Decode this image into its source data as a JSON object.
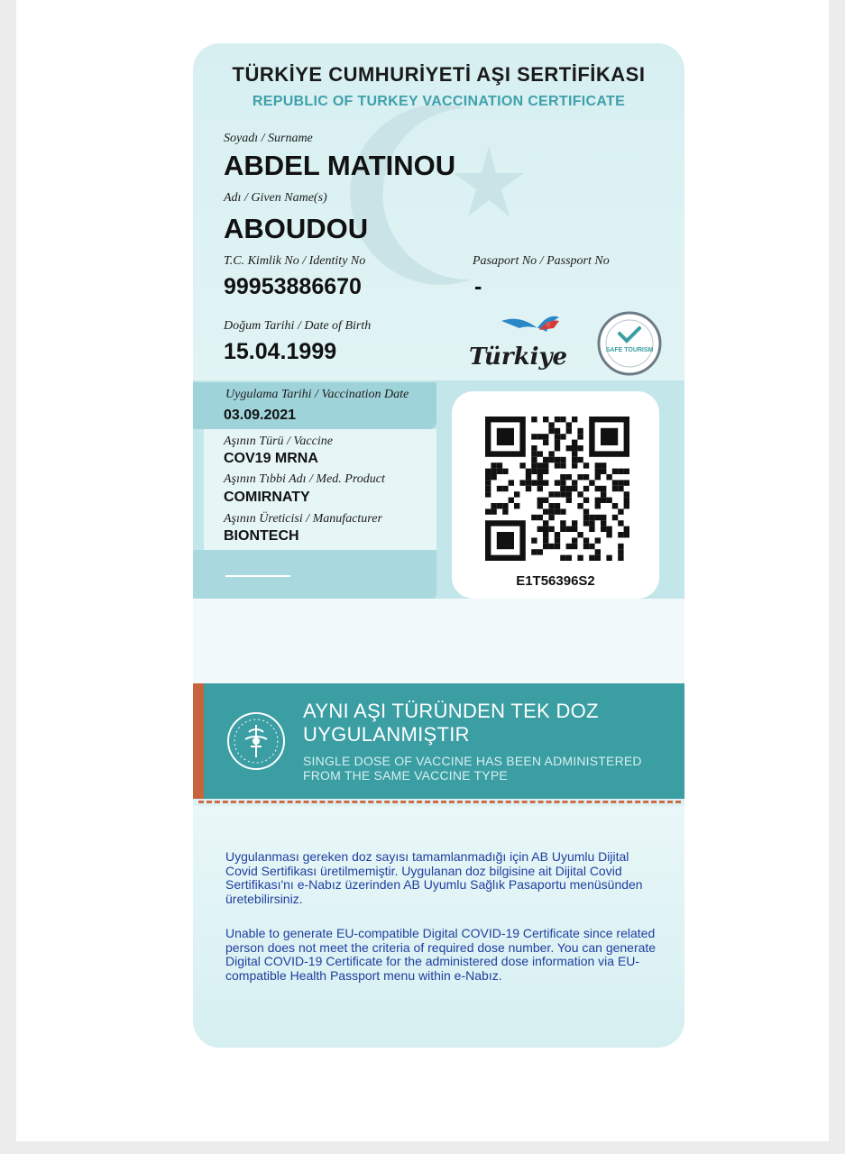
{
  "certificate": {
    "title_tr": "TÜRKİYE CUMHURİYETİ AŞI SERTİFİKASI",
    "title_en": "REPUBLIC OF TURKEY VACCINATION CERTIFICATE"
  },
  "person": {
    "surname_label": "Soyadı / Surname",
    "surname": "ABDEL MATINOU",
    "given_name_label": "Adı / Given Name(s)",
    "given_name": "ABOUDOU",
    "identity_label": "T.C. Kimlik No / Identity No",
    "identity": "99953886670",
    "passport_label": "Pasaport No / Passport No",
    "passport": "-",
    "dob_label": "Doğum Tarihi / Date of Birth",
    "dob": "15.04.1999"
  },
  "logos": {
    "turkiye_wordmark": "Türkiye",
    "safe_tourism_text": "SAFE TOURISM",
    "colors": {
      "crescent": "#c9e3e6",
      "qr_dark": "#111111",
      "teal_banner": "#3a9ea3",
      "accent": "#c8643d",
      "note_text": "#1f3fa0"
    }
  },
  "vaccination": {
    "date_label": "Uygulama Tarihi / Vaccination Date",
    "date": "03.09.2021",
    "vaccine_label": "Aşının Türü / Vaccine",
    "vaccine": "COV19 MRNA",
    "product_label": "Aşının Tıbbi Adı / Med. Product",
    "product": "COMIRNATY",
    "manufacturer_label": "Aşının Üreticisi / Manufacturer",
    "manufacturer": "BIONTECH"
  },
  "qr": {
    "code": "E1T56396S2",
    "icon": "qr-code-icon"
  },
  "banner": {
    "title_tr": "AYNI AŞI TÜRÜNDEN TEK DOZ UYGULANMIŞTIR",
    "title_en": "SINGLE DOSE OF VACCINE HAS BEEN ADMINISTERED FROM THE SAME VACCINE TYPE",
    "icon": "ministry-of-health-seal-icon"
  },
  "notes": {
    "tr": "Uygulanması gereken doz sayısı tamamlanmadığı için AB Uyumlu Dijital Covid Sertifikası üretilmemiştir. Uygulanan doz bilgisine ait Dijital Covid Sertifikası'nı e-Nabız üzerinden AB Uyumlu Sağlık Pasaportu menüsünden üretebilirsiniz.",
    "en": "Unable to generate EU-compatible Digital COVID-19 Certificate since related person does not meet the criteria of required dose number. You can generate Digital COVID-19 Certificate for the administered dose information via EU-compatible Health Passport menu within e-Nabız."
  }
}
